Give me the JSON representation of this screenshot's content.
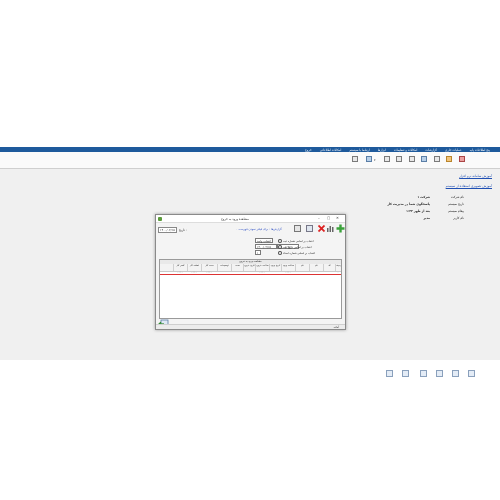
{
  "menubar": {
    "items": [
      "پنج اطلاعات پایه",
      "عملیات جاری",
      "گزارشات",
      "امکانات و تنظیمات",
      "ابزارها",
      "ارتباط با سیستم",
      "امکانات اطلاعاتی",
      "خروج"
    ]
  },
  "toolbar": {
    "buttons": [
      "exit-icon",
      "print-icon",
      "save-icon",
      "grid-icon",
      "list-icon",
      "report-icon",
      "export-icon",
      "refresh-icon",
      "tools-icon"
    ]
  },
  "links": {
    "first": "آموزش سامانه نرم افزار",
    "second": "آموزش تصویری استفاده از سیستم"
  },
  "info": [
    {
      "label": "نام شرکت",
      "value": "شرکت ۱"
    },
    {
      "label": "تاریخ سیستم",
      "value": "پاسخگوی شما در مدیریت کار"
    },
    {
      "label": "پیغام سیستم",
      "value": "۱:۳۳ بعد از ظهر"
    },
    {
      "label": "نام کاربر",
      "value": "مدیر"
    }
  ],
  "dialog": {
    "title": "مشاهده ورود به خروج",
    "date_label": "تاریخ :",
    "date_value": "۱۴۰۰/۰۲/۱۵",
    "filter_link": "۰ گزارش‌ها : برای فیلتر نمودن فهرست",
    "search_value": "انتخاب واحد",
    "from_date": "۱۴۰۰/۰۲/۱۵",
    "to_date": "۱۴۰۰/۰۳/۱۰",
    "small_value": "۱",
    "radio_options": [
      "انتخاب بر اساس شماره ثبت",
      "انتخاب بر اساس تاریخ ثبت",
      "انتخاب بر اساس شماره اسناد"
    ],
    "grid_group_header": "مشاهده ورود به خروج",
    "grid_headers": [
      "ردیف",
      "کد",
      "نام",
      "نام",
      "ساعت ورود",
      "تاریخ ورود",
      "ساعت خروج",
      "تاریخ خروج",
      "مدت",
      "توضیحات",
      "مدت کار",
      "اضافه کار",
      "کسر کار"
    ],
    "grid_row": [
      "۰",
      "",
      "",
      "",
      "۰۰:۰۰",
      "",
      "۰۰:۰۰",
      "",
      "",
      "",
      "۰۰:۰۰",
      "۰۰:۰۰",
      "۰۰:۰۰"
    ],
    "status_text": "آماده"
  },
  "bottom_icons": [
    "exit-icon",
    "window-icon",
    "grid-icon",
    "report-icon",
    "list-icon",
    "table-icon"
  ]
}
